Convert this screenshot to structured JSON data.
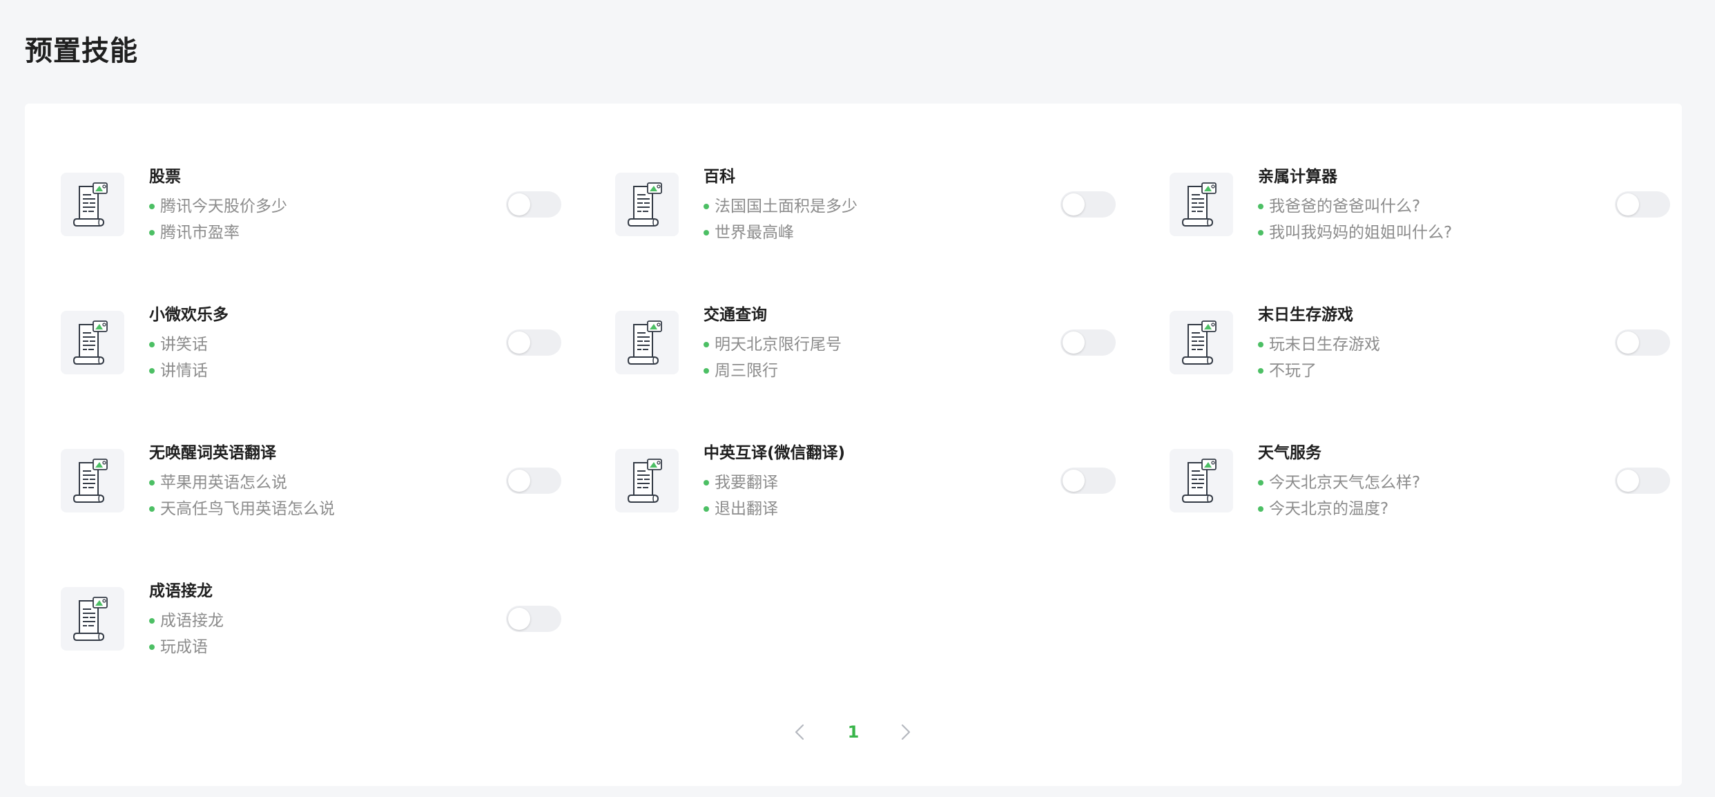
{
  "page": {
    "title": "预置技能"
  },
  "colors": {
    "accent": "#39b54a",
    "bullet": "#4cbf64",
    "toggle_off": "#eeeff2",
    "page_background": "#f5f6f8"
  },
  "skill_icon": "scroll-document-icon",
  "skills": [
    {
      "name": "股票",
      "examples": [
        "腾讯今天股价多少",
        "腾讯市盈率"
      ],
      "enabled": false
    },
    {
      "name": "百科",
      "examples": [
        "法国国土面积是多少",
        "世界最高峰"
      ],
      "enabled": false
    },
    {
      "name": "亲属计算器",
      "examples": [
        "我爸爸的爸爸叫什么?",
        "我叫我妈妈的姐姐叫什么?"
      ],
      "enabled": false
    },
    {
      "name": "小微欢乐多",
      "examples": [
        "讲笑话",
        "讲情话"
      ],
      "enabled": false
    },
    {
      "name": "交通查询",
      "examples": [
        "明天北京限行尾号",
        "周三限行"
      ],
      "enabled": false
    },
    {
      "name": "末日生存游戏",
      "examples": [
        "玩末日生存游戏",
        "不玩了"
      ],
      "enabled": false
    },
    {
      "name": "无唤醒词英语翻译",
      "examples": [
        "苹果用英语怎么说",
        "天高任鸟飞用英语怎么说"
      ],
      "enabled": false
    },
    {
      "name": "中英互译(微信翻译)",
      "examples": [
        "我要翻译",
        "退出翻译"
      ],
      "enabled": false
    },
    {
      "name": "天气服务",
      "examples": [
        "今天北京天气怎么样?",
        "今天北京的温度?"
      ],
      "enabled": false
    },
    {
      "name": "成语接龙",
      "examples": [
        "成语接龙",
        "玩成语"
      ],
      "enabled": false
    }
  ],
  "pagination": {
    "current_page": "1",
    "prev_icon": "chevron-left-icon",
    "next_icon": "chevron-right-icon"
  }
}
